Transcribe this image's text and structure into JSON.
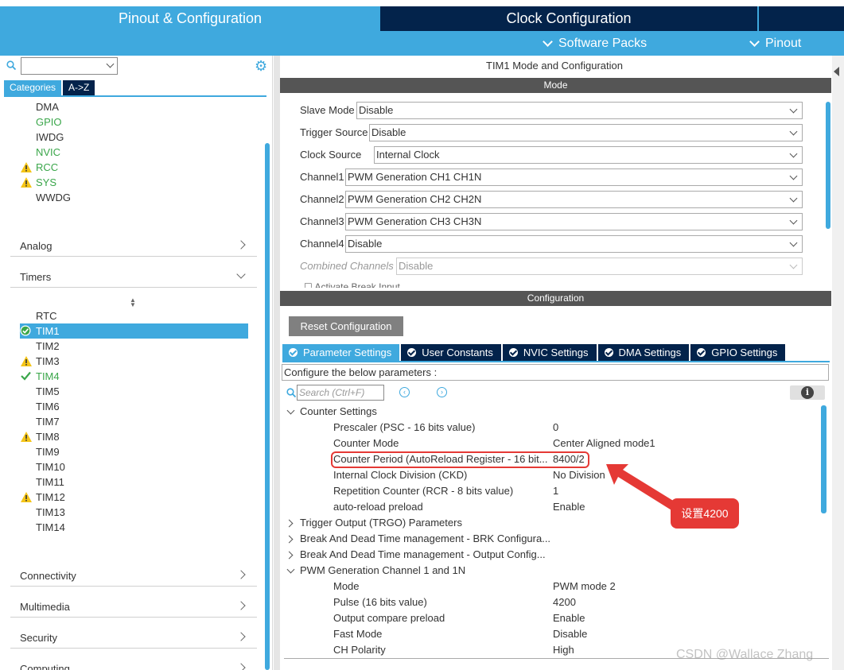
{
  "header": {
    "tab_pinout": "Pinout & Configuration",
    "tab_clock": "Clock Configuration",
    "software_packs": "Software Packs",
    "pinout_menu": "Pinout"
  },
  "sidebar": {
    "categories_tab": "Categories",
    "az_tab": "A->Z",
    "system_items": [
      {
        "label": "DMA",
        "status": "none"
      },
      {
        "label": "GPIO",
        "status": "ok"
      },
      {
        "label": "IWDG",
        "status": "none"
      },
      {
        "label": "NVIC",
        "status": "ok"
      },
      {
        "label": "RCC",
        "status": "warning"
      },
      {
        "label": "SYS",
        "status": "warning"
      },
      {
        "label": "WWDG",
        "status": "none"
      }
    ],
    "sections": {
      "analog": "Analog",
      "timers": "Timers",
      "connectivity": "Connectivity",
      "multimedia": "Multimedia",
      "security": "Security",
      "computing": "Computing"
    },
    "timers": [
      {
        "label": "RTC",
        "status": "none"
      },
      {
        "label": "TIM1",
        "status": "selected"
      },
      {
        "label": "TIM2",
        "status": "none"
      },
      {
        "label": "TIM3",
        "status": "warning"
      },
      {
        "label": "TIM4",
        "status": "ok"
      },
      {
        "label": "TIM5",
        "status": "none"
      },
      {
        "label": "TIM6",
        "status": "none"
      },
      {
        "label": "TIM7",
        "status": "none"
      },
      {
        "label": "TIM8",
        "status": "warning"
      },
      {
        "label": "TIM9",
        "status": "none"
      },
      {
        "label": "TIM10",
        "status": "none"
      },
      {
        "label": "TIM11",
        "status": "none"
      },
      {
        "label": "TIM12",
        "status": "warning"
      },
      {
        "label": "TIM13",
        "status": "none"
      },
      {
        "label": "TIM14",
        "status": "none"
      }
    ]
  },
  "main": {
    "title": "TIM1 Mode and Configuration",
    "mode_header": "Mode",
    "mode_rows": [
      {
        "label": "Slave Mode",
        "value": "Disable",
        "disabled": false
      },
      {
        "label": "Trigger Source",
        "value": "Disable",
        "disabled": false
      },
      {
        "label": "Clock Source",
        "value": "Internal Clock",
        "disabled": false
      },
      {
        "label": "Channel1",
        "value": "PWM Generation CH1 CH1N",
        "disabled": false
      },
      {
        "label": "Channel2",
        "value": "PWM Generation CH2 CH2N",
        "disabled": false
      },
      {
        "label": "Channel3",
        "value": "PWM Generation CH3 CH3N",
        "disabled": false
      },
      {
        "label": "Channel4",
        "value": "Disable",
        "disabled": false
      },
      {
        "label": "Combined Channels",
        "value": "Disable",
        "disabled": true
      }
    ],
    "mode_cut_text": "Activate Break Input",
    "config_header": "Configuration",
    "reset_button": "Reset Configuration",
    "tabs": [
      {
        "label": "Parameter Settings",
        "active": true
      },
      {
        "label": "User Constants",
        "active": false
      },
      {
        "label": "NVIC Settings",
        "active": false
      },
      {
        "label": "DMA Settings",
        "active": false
      },
      {
        "label": "GPIO Settings",
        "active": false
      }
    ],
    "config_description": "Configure the below parameters :",
    "search_placeholder": "Search (Ctrl+F)",
    "counter_settings": {
      "title": "Counter Settings",
      "params": [
        {
          "name": "Prescaler (PSC - 16 bits value)",
          "value": "0"
        },
        {
          "name": "Counter Mode",
          "value": "Center Aligned mode1"
        },
        {
          "name": "Counter Period (AutoReload Register - 16 bit...",
          "value": "8400/2"
        },
        {
          "name": "Internal Clock Division (CKD)",
          "value": "No Division"
        },
        {
          "name": "Repetition Counter (RCR - 8 bits value)",
          "value": "1"
        },
        {
          "name": "auto-reload preload",
          "value": "Enable"
        }
      ]
    },
    "collapsed_groups": [
      "Trigger Output (TRGO) Parameters",
      "Break And Dead Time management - BRK Configura...",
      "Break And Dead Time management - Output Config..."
    ],
    "pwm_channel1": {
      "title": "PWM Generation Channel 1 and 1N",
      "params": [
        {
          "name": "Mode",
          "value": "PWM mode 2"
        },
        {
          "name": "Pulse (16 bits value)",
          "value": "4200"
        },
        {
          "name": "Output compare preload",
          "value": "Enable"
        },
        {
          "name": "Fast Mode",
          "value": "Disable"
        },
        {
          "name": "CH Polarity",
          "value": "High"
        }
      ]
    }
  },
  "annotation": {
    "callout": "设置4200",
    "color": "#e53935"
  },
  "watermark": "CSDN @Wallace Zhang",
  "colors": {
    "accent": "#3fa9de",
    "dark": "#03234b",
    "ok": "#3aa64a",
    "warning": "#f5c518"
  }
}
